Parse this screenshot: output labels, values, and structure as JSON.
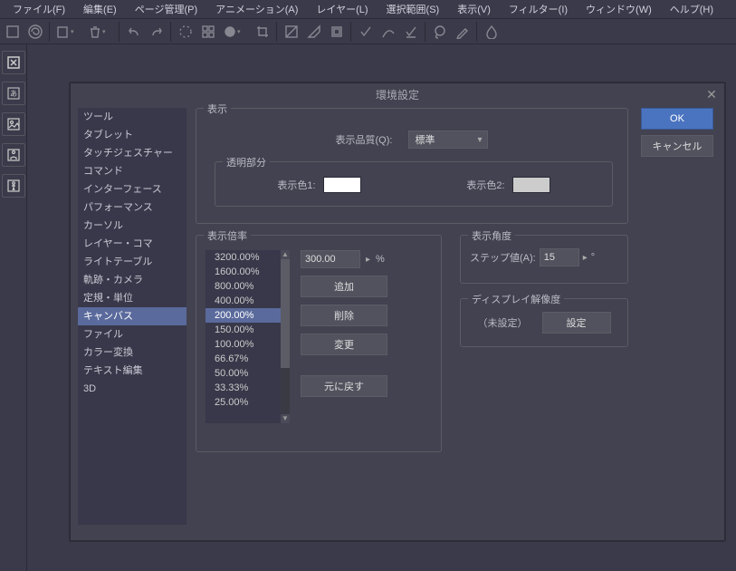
{
  "menus": {
    "file": "ファイル(F)",
    "edit": "編集(E)",
    "page": "ページ管理(P)",
    "anim": "アニメーション(A)",
    "layer": "レイヤー(L)",
    "select": "選択範囲(S)",
    "view": "表示(V)",
    "filter": "フィルター(I)",
    "window": "ウィンドウ(W)",
    "help": "ヘルプ(H)"
  },
  "dialog": {
    "title": "環境設定",
    "ok": "OK",
    "cancel": "キャンセル",
    "categories": [
      "ツール",
      "タブレット",
      "タッチジェスチャー",
      "コマンド",
      "インターフェース",
      "パフォーマンス",
      "カーソル",
      "レイヤー・コマ",
      "ライトテーブル",
      "軌跡・カメラ",
      "定規・単位",
      "キャンバス",
      "ファイル",
      "カラー変換",
      "テキスト編集",
      "3D"
    ],
    "selectedCategory": "キャンバス",
    "displayGroup": {
      "legend": "表示",
      "qualityLabel": "表示品質(Q):",
      "qualityValue": "標準",
      "transLegend": "透明部分",
      "color1Label": "表示色1:",
      "color1": "#ffffff",
      "color2Label": "表示色2:",
      "color2": "#cccccc"
    },
    "zoomGroup": {
      "legend": "表示倍率",
      "levels": [
        "3200.00%",
        "1600.00%",
        "800.00%",
        "400.00%",
        "200.00%",
        "150.00%",
        "100.00%",
        "66.67%",
        "50.00%",
        "33.33%",
        "25.00%"
      ],
      "selected": "200.00%",
      "inputValue": "300.00",
      "unit": "%",
      "btnAdd": "追加",
      "btnDelete": "削除",
      "btnChange": "変更",
      "btnReset": "元に戻す"
    },
    "angleGroup": {
      "legend": "表示角度",
      "stepLabel": "ステップ値(A):",
      "stepValue": "15",
      "unit": "°"
    },
    "resGroup": {
      "legend": "ディスプレイ解像度",
      "status": "（未設定）",
      "btn": "設定"
    }
  }
}
